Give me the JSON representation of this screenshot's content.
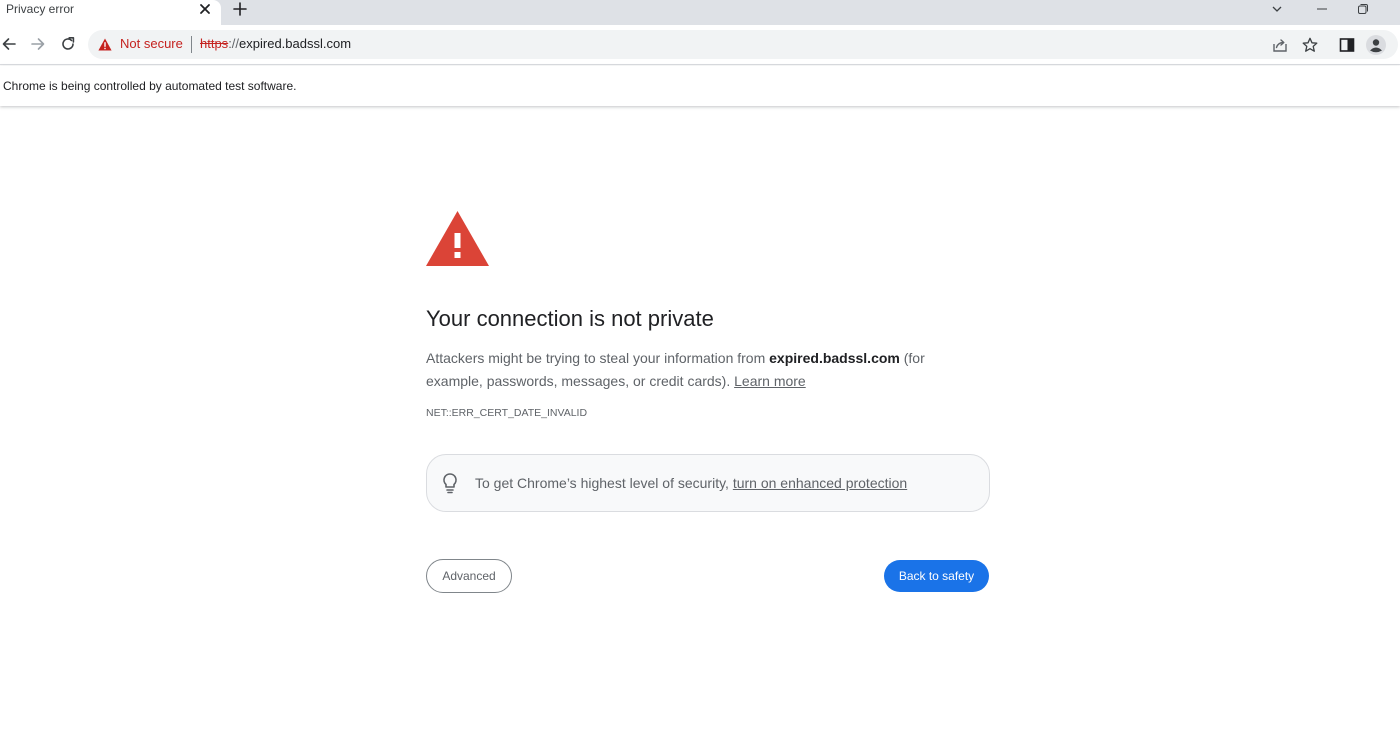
{
  "tab": {
    "title": "Privacy error"
  },
  "toolbar": {
    "security_label": "Not secure",
    "url_scheme": "https",
    "url_separator": "://",
    "url_host": "expired.badssl.com"
  },
  "infobar": {
    "text": "Chrome is being controlled by automated test software."
  },
  "interstitial": {
    "heading": "Your connection is not private",
    "explanation_prefix": "Attackers might be trying to steal your information from ",
    "explanation_host": "expired.badssl.com",
    "explanation_suffix": " (for example, passwords, messages, or credit cards). ",
    "learn_more": "Learn more",
    "error_code": "NET::ERR_CERT_DATE_INVALID",
    "enhanced_prefix": "To get Chrome’s highest level of security, ",
    "enhanced_link": "turn on enhanced protection",
    "advanced_button": "Advanced",
    "back_button": "Back to safety"
  },
  "colors": {
    "tabstrip_bg": "#dee1e6",
    "omnibox_bg": "#f1f3f4",
    "danger_red": "#c5221f",
    "warning_triangle": "#db4437",
    "primary_blue": "#1a73e8",
    "text_secondary": "#5f6368"
  },
  "icons": {
    "tab_close": "close-icon",
    "new_tab": "plus-icon",
    "tab_search": "chevron-down-icon",
    "minimize": "minimize-icon",
    "restore": "restore-icon",
    "back": "arrow-left-icon",
    "forward": "arrow-right-icon",
    "reload": "reload-icon",
    "not_secure": "warning-triangle-icon",
    "share": "share-icon",
    "bookmark": "star-icon",
    "side_panel": "side-panel-icon",
    "profile": "profile-avatar-icon",
    "interstitial": "warning-triangle-icon",
    "tip": "lightbulb-icon"
  }
}
